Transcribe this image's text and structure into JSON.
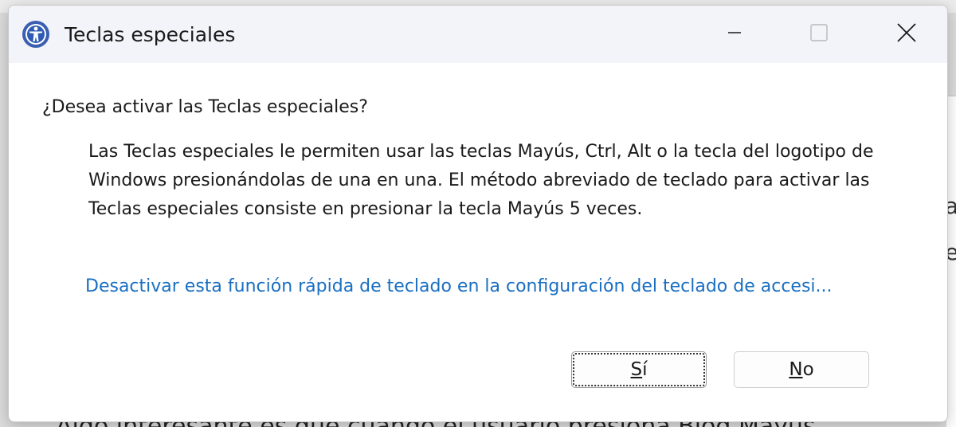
{
  "window": {
    "title": "Teclas especiales",
    "icon": "accessibility-icon",
    "controls": {
      "minimize": "minimize-icon",
      "maximize": "maximize-icon",
      "close": "close-icon"
    }
  },
  "dialog": {
    "heading": "¿Desea activar las Teclas especiales?",
    "description": "Las Teclas especiales le permiten usar las teclas Mayús, Ctrl, Alt o la tecla del logotipo de Windows presionándolas de una en una. El método abreviado de teclado para activar las Teclas especiales consiste en presionar la tecla Mayús 5 veces.",
    "settings_link": "Desactivar esta función rápida de teclado en la configuración del teclado de accesi...",
    "buttons": {
      "yes_mnemonic": "S",
      "yes_rest": "í",
      "no_mnemonic": "N",
      "no_rest": "o"
    }
  },
  "background": {
    "text": "Algo interesante es que cuando el usuario presiona Bloq Mayús"
  },
  "colors": {
    "link": "#1a6fc2",
    "titlebar": "#f2f4f9"
  }
}
